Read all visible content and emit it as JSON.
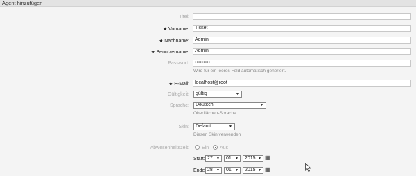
{
  "panel": {
    "title": "Agent hinzufügen"
  },
  "form": {
    "title_label": "Titel:",
    "title_value": "",
    "firstname_label": "Vorname:",
    "firstname_value": "Ticket",
    "lastname_label": "Nachname:",
    "lastname_value": "Admin",
    "username_label": "Benutzername:",
    "username_value": "Admin",
    "password_label": "Passwort:",
    "password_value": "•••••••••",
    "password_hint": "Wird für ein leeres Feld automatisch generiert.",
    "email_label": "E-Mail:",
    "email_value": "localhost@root",
    "validity_label": "Gültigkeit:",
    "validity_value": "gültig",
    "language_label": "Sprache:",
    "language_value": "Deutsch",
    "language_hint": "Oberflächen-Sprache",
    "skin_label": "Skin:",
    "skin_value": "Default",
    "skin_hint": "Diesen Skin verwenden",
    "absence_label": "Abwesenheitszeit:",
    "absence_on": "Ein",
    "absence_off": "Aus",
    "absence_selected": "Aus",
    "start_label": "Start:",
    "start_day": "27",
    "start_month": "01",
    "start_year": "2015",
    "end_label": "Ende:",
    "end_day": "28",
    "end_month": "01",
    "end_year": "2015",
    "required_marker": "★"
  },
  "icons": {
    "dropdown": "chevron-down-icon",
    "calendar": "calendar-icon",
    "cursor": "mouse-pointer-icon"
  }
}
